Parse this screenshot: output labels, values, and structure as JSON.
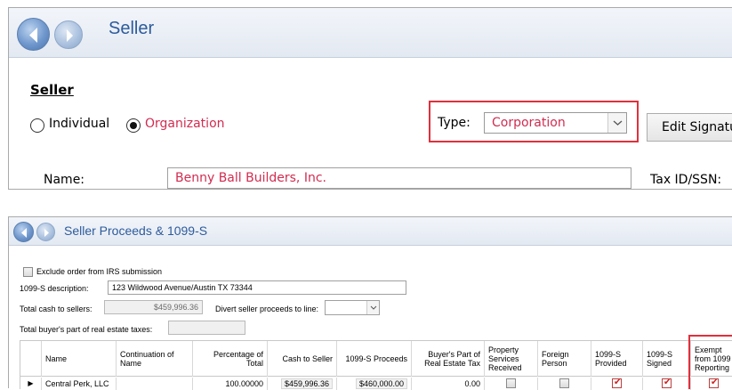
{
  "seller_panel": {
    "title": "Seller",
    "section_label": "Seller",
    "radio_individual": "Individual",
    "radio_organization": "Organization",
    "type_label": "Type:",
    "type_value": "Corporation",
    "edit_signature_label": "Edit Signature",
    "name_label": "Name:",
    "name_value": "Benny Ball Builders, Inc.",
    "tax_label": "Tax ID/SSN:",
    "selected_type": "organization"
  },
  "proceeds_panel": {
    "title": "Seller Proceeds & 1099-S",
    "exclude_label": "Exclude order from IRS submission",
    "description_label": "1099-S description:",
    "description_value": "123 Wildwood Avenue/Austin TX 73344",
    "total_cash_label": "Total cash to sellers:",
    "total_cash_value": "$459,996.36",
    "divert_label": "Divert seller proceeds to line:",
    "buyer_part_label": "Total buyer's part of real estate taxes:",
    "columns": {
      "name": "Name",
      "continuation": "Continuation of Name",
      "percentage": "Percentage of Total",
      "cash_to_seller": "Cash to Seller",
      "proceeds": "1099-S Proceeds",
      "buyer_tax": "Buyer's Part of Real Estate Tax",
      "property_services": "Property Services Received",
      "foreign": "Foreign Person",
      "provided": "1099-S Provided",
      "signed": "1099-S Signed",
      "exempt": "Exempt from 1099 Reporting"
    },
    "rows": [
      {
        "name": "Central Perk, LLC",
        "continuation": "",
        "percentage": "100.00000",
        "cash_to_seller": "$459,996.36",
        "proceeds": "$460,000.00",
        "buyer_tax": "0.00"
      }
    ],
    "row_indicator": "▶"
  },
  "colors": {
    "accent_red": "#d12c50",
    "highlight_border": "#e0303c",
    "title_blue": "#2d5b9b"
  }
}
